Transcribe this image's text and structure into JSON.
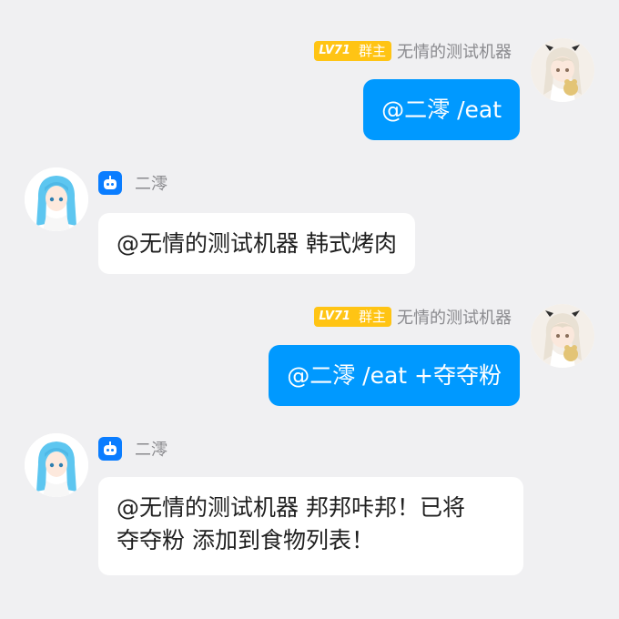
{
  "messages": [
    {
      "sender": "无情的测试机器",
      "level": "LV71",
      "role": "群主",
      "text": "@二澪 /eat"
    },
    {
      "sender": "二澪",
      "text": "@无情的测试机器 韩式烤肉"
    },
    {
      "sender": "无情的测试机器",
      "level": "LV71",
      "role": "群主",
      "text": "@二澪 /eat +夺夺粉"
    },
    {
      "sender": "二澪",
      "lines": [
        "@无情的测试机器 邦邦咔邦！已将",
        "夺夺粉 添加到食物列表！"
      ]
    }
  ],
  "colors": {
    "background": "#f0f0f2",
    "my_bubble": "#0099ff",
    "bot_bubble": "#ffffff",
    "level_badge": "#ffc414",
    "bot_badge": "#0a7dff"
  },
  "icons": {
    "bot_badge": "robot-icon",
    "user_avatar": "girl-with-plush-avatar",
    "bot_avatar": "blue-hair-girl-avatar"
  }
}
